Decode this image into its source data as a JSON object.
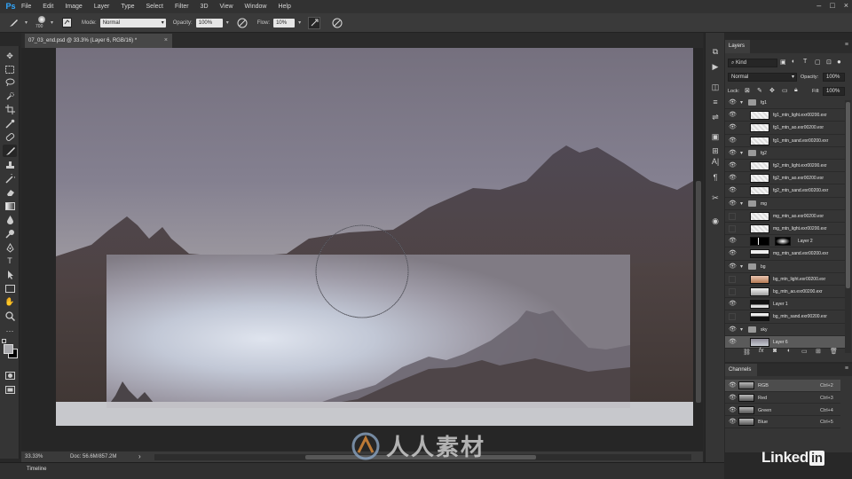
{
  "app": {
    "logo": "Ps"
  },
  "menu": [
    "File",
    "Edit",
    "Image",
    "Layer",
    "Type",
    "Select",
    "Filter",
    "3D",
    "View",
    "Window",
    "Help"
  ],
  "window_controls": [
    "–",
    "□",
    "×"
  ],
  "options_bar": {
    "brush_size": "700",
    "mode_label": "Mode:",
    "mode_value": "Normal",
    "opacity_label": "Opacity:",
    "opacity_value": "100%",
    "flow_label": "Flow:",
    "flow_value": "10%"
  },
  "document": {
    "tab_title": "07_03_end.psd @ 33.3% (Layer 6, RGB/16) *",
    "close_glyph": "×"
  },
  "status": {
    "zoom": "33.33%",
    "doc_info": "Doc: 56.6M/857.2M",
    "arrow": "›"
  },
  "timeline": {
    "label": "Timeline"
  },
  "layers_panel": {
    "tab": "Layers",
    "filter_kind": "Kind",
    "blend_mode": "Normal",
    "opacity_label": "Opacity:",
    "opacity_value": "100%",
    "lock_label": "Lock:",
    "fill_label": "Fill:",
    "fill_value": "100%",
    "layers": [
      {
        "name": "fg1",
        "kind": "group",
        "visible": true
      },
      {
        "name": "fg1_mtn_light.exr00200.exr",
        "kind": "layer",
        "visible": true
      },
      {
        "name": "fg1_mtn_ao.exr00200.exr",
        "kind": "layer",
        "visible": true
      },
      {
        "name": "fg1_mtn_sand.exr00200.exr",
        "kind": "layer",
        "visible": true
      },
      {
        "name": "fg2",
        "kind": "group",
        "visible": true
      },
      {
        "name": "fg2_mtn_light.exr00200.exr",
        "kind": "layer",
        "visible": true
      },
      {
        "name": "fg2_mtn_ao.exr00200.exr",
        "kind": "layer",
        "visible": true
      },
      {
        "name": "fg2_mtn_sand.exr00200.exr",
        "kind": "layer",
        "visible": true
      },
      {
        "name": "mg",
        "kind": "group",
        "visible": true
      },
      {
        "name": "mg_mtn_ao.exr00200.exr",
        "kind": "layer",
        "visible": false
      },
      {
        "name": "mg_mtn_light.exr00200.exr",
        "kind": "layer",
        "visible": false
      },
      {
        "name": "Layer 2",
        "kind": "layer",
        "visible": true
      },
      {
        "name": "mg_mtn_sand.exr00200.exr",
        "kind": "layer",
        "visible": true
      },
      {
        "name": "bg",
        "kind": "group",
        "visible": true
      },
      {
        "name": "bg_mtn_light.exr00200.exr",
        "kind": "layer",
        "visible": false
      },
      {
        "name": "bg_mtn_ao.exr00200.exr",
        "kind": "layer",
        "visible": false
      },
      {
        "name": "Layer 1",
        "kind": "layer",
        "visible": true
      },
      {
        "name": "bg_mtn_sand.exr00200.exr",
        "kind": "layer",
        "visible": false
      },
      {
        "name": "sky",
        "kind": "group",
        "visible": true
      },
      {
        "name": "Layer 6",
        "kind": "layer",
        "visible": true,
        "selected": true
      }
    ]
  },
  "channels_panel": {
    "tab": "Channels",
    "channels": [
      {
        "name": "RGB",
        "shortcut": "Ctrl+2"
      },
      {
        "name": "Red",
        "shortcut": "Ctrl+3"
      },
      {
        "name": "Green",
        "shortcut": "Ctrl+4"
      },
      {
        "name": "Blue",
        "shortcut": "Ctrl+5"
      }
    ]
  },
  "branding": {
    "linkedin_text": "Linked",
    "linkedin_in": "in",
    "watermark_text": "人人素材"
  },
  "colors": {
    "accent": "#31a8ff",
    "sky_top": "#7e7886",
    "selected_layer": "#5a5a5a"
  }
}
